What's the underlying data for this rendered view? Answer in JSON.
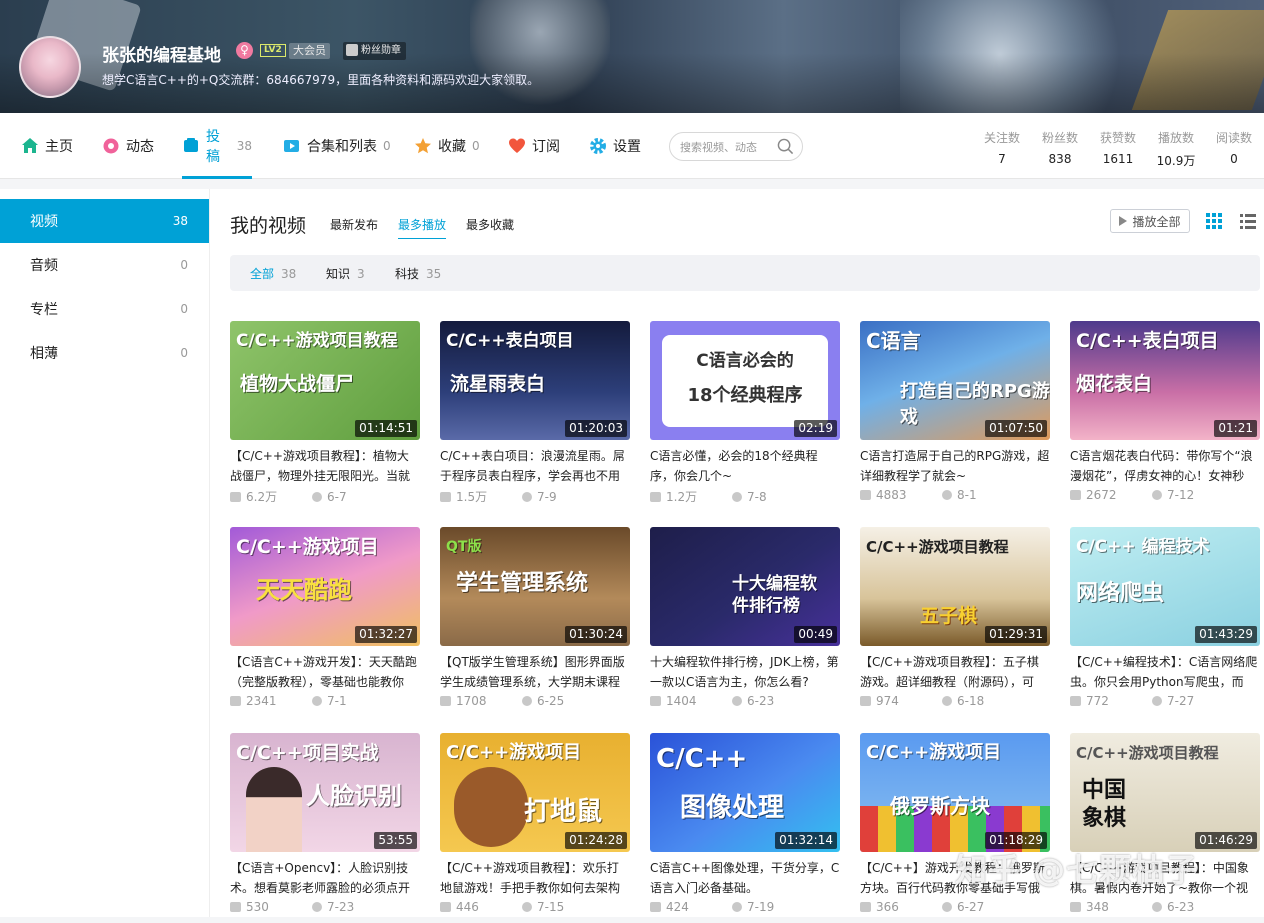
{
  "banner": {
    "username": "张张的编程基地",
    "gender_symbol": "♀",
    "level": "LV2",
    "vip": "大会员",
    "fan_badge": "粉丝勋章",
    "signature": "想学C语言C++的+Q交流群：684667979，里面各种资料和源码欢迎大家领取。"
  },
  "nav": {
    "items": [
      {
        "label": "主页",
        "count": "",
        "icon": "home-icon"
      },
      {
        "label": "动态",
        "count": "",
        "icon": "dynamic-icon"
      },
      {
        "label": "投稿",
        "count": "38",
        "icon": "upload-icon"
      },
      {
        "label": "合集和列表",
        "count": "0",
        "icon": "collection-icon"
      },
      {
        "label": "收藏",
        "count": "0",
        "icon": "star-icon"
      },
      {
        "label": "订阅",
        "count": "",
        "icon": "heart-icon"
      },
      {
        "label": "设置",
        "count": "",
        "icon": "gear-icon"
      }
    ],
    "search_placeholder": "搜索视频、动态",
    "stats": [
      {
        "label": "关注数",
        "value": "7"
      },
      {
        "label": "粉丝数",
        "value": "838"
      },
      {
        "label": "获赞数",
        "value": "1611"
      },
      {
        "label": "播放数",
        "value": "10.9万"
      },
      {
        "label": "阅读数",
        "value": "0"
      }
    ]
  },
  "sidebar": {
    "items": [
      {
        "label": "视频",
        "count": "38"
      },
      {
        "label": "音频",
        "count": "0"
      },
      {
        "label": "专栏",
        "count": "0"
      },
      {
        "label": "相薄",
        "count": "0"
      }
    ]
  },
  "main": {
    "title": "我的视频",
    "sorts": [
      "最新发布",
      "最多播放",
      "最多收藏"
    ],
    "play_all": "播放全部",
    "filters": [
      {
        "label": "全部",
        "count": "38"
      },
      {
        "label": "知识",
        "count": "3"
      },
      {
        "label": "科技",
        "count": "35"
      }
    ]
  },
  "videos": [
    {
      "t1": "C/C++游戏项目教程",
      "t2": "植物大战僵尸",
      "dur": "01:14:51",
      "title": "【C/C++游戏项目教程】：植物大战僵尸，物理外挂无限阳光。当就",
      "plays": "6.2万",
      "date": "6-7"
    },
    {
      "t1": "C/C++表白项目",
      "t2": "流星雨表白",
      "dur": "01:20:03",
      "title": "C/C++表白项目：浪漫流星雨。屌于程序员表白程序，学会再也不用",
      "plays": "1.5万",
      "date": "7-9"
    },
    {
      "t1": "C语言必会的",
      "t2": "18个经典程序",
      "dur": "02:19",
      "title": "C语言必懂，必会的18个经典程序，你会几个~",
      "plays": "1.2万",
      "date": "7-8"
    },
    {
      "t1": "C语言",
      "t2": "打造自己的RPG游戏",
      "dur": "01:07:50",
      "title": "C语言打造屌于自己的RPG游戏，超详细教程学了就会~",
      "plays": "4883",
      "date": "8-1"
    },
    {
      "t1": "C/C++表白项目",
      "t2": "烟花表白",
      "dur": "01:21",
      "title": "C语言烟花表白代码：带你写个“浪漫烟花”，俘虏女神的心！女神秒",
      "plays": "2672",
      "date": "7-12"
    },
    {
      "t1": "C/C++游戏项目",
      "t2": "天天酷跑",
      "dur": "01:32:27",
      "title": "【C语言C++游戏开发】：天天酷跑（完整版教程），零基础也能教你",
      "plays": "2341",
      "date": "7-1"
    },
    {
      "t1": "QT版",
      "t2": "学生管理系统",
      "dur": "01:30:24",
      "title": "【QT版学生管理系统】图形界面版学生成绩管理系统，大学期末课程",
      "plays": "1708",
      "date": "6-25"
    },
    {
      "t1": "",
      "t2": "十大编程软件排行榜",
      "dur": "00:49",
      "title": "十大编程软件排行榜，JDK上榜，第一款以C语言为主，你怎么看?",
      "plays": "1404",
      "date": "6-23"
    },
    {
      "t1": "C/C++游戏项目教程",
      "t2": "五子棋",
      "dur": "01:29:31",
      "title": "【C/C++游戏项目教程】：五子棋游戏。超详细教程（附源码），可",
      "plays": "974",
      "date": "6-18"
    },
    {
      "t1": "C/C++ 编程技术",
      "t2": "网络爬虫",
      "dur": "01:43:29",
      "title": "【C/C++编程技术】：C语言网络爬虫。你只会用Python写爬虫，而",
      "plays": "772",
      "date": "7-27"
    },
    {
      "t1": "C/C++项目实战",
      "t2": "人脸识别",
      "dur": "53:55",
      "title": "【C语言+Opencv】：人脸识别技术。想看莫影老师露脸的必须点开",
      "plays": "530",
      "date": "7-23"
    },
    {
      "t1": "C/C++游戏项目",
      "t2": "打地鼠",
      "dur": "01:24:28",
      "title": "【C/C++游戏项目教程】：欢乐打地鼠游戏！手把手教你如何去架构",
      "plays": "446",
      "date": "7-15"
    },
    {
      "t1": "C/C++",
      "t2": "图像处理",
      "dur": "01:32:14",
      "title": "C语言C++图像处理，干货分享，C语言入门必备基础。",
      "plays": "424",
      "date": "7-19"
    },
    {
      "t1": "C/C++游戏项目",
      "t2": "俄罗斯方块",
      "dur": "01:18:29",
      "title": "【C/C++】游戏开发教程：俄罗斯方块。百行代码教你零基础手写俄",
      "plays": "366",
      "date": "6-27"
    },
    {
      "t1": "C/C++游戏项目教程",
      "t2": "中国象棋",
      "dur": "01:46:29",
      "title": "【C/C++游戏项目教程】：中国象棋。暑假内卷开始了~教你一个视频",
      "plays": "348",
      "date": "6-23"
    }
  ],
  "watermark": "知乎 @七颗柚子"
}
